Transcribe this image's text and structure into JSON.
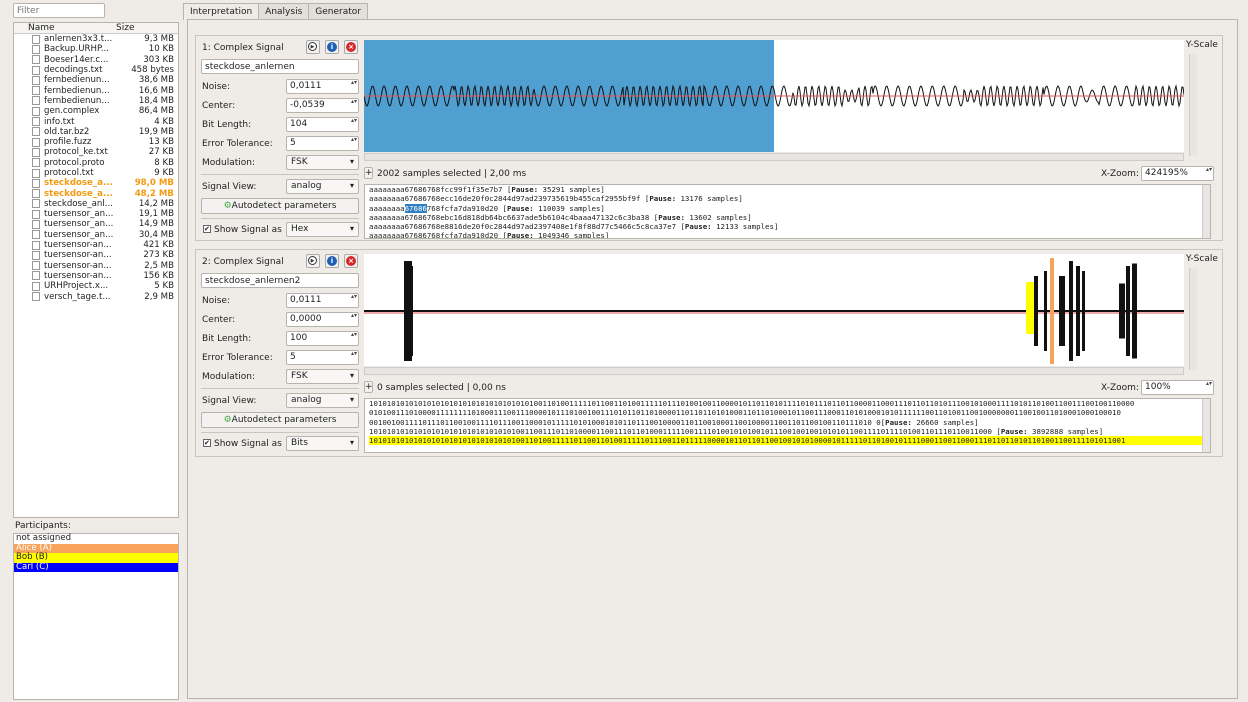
{
  "filter_placeholder": "Filter",
  "tree": {
    "headers": [
      "Name",
      "Size"
    ],
    "files": [
      {
        "name": "anlernen3x3.t...",
        "size": "9,3 MB"
      },
      {
        "name": "Backup.URHP...",
        "size": "10 KB"
      },
      {
        "name": "Boeser14er.c...",
        "size": "303 KB"
      },
      {
        "name": "decodings.txt",
        "size": "458 bytes"
      },
      {
        "name": "fernbedienun...",
        "size": "38,6 MB"
      },
      {
        "name": "fernbedienun...",
        "size": "16,6 MB"
      },
      {
        "name": "fernbedienun...",
        "size": "18,4 MB"
      },
      {
        "name": "gen.complex",
        "size": "86,4 MB"
      },
      {
        "name": "info.txt",
        "size": "4 KB"
      },
      {
        "name": "old.tar.bz2",
        "size": "19,9 MB"
      },
      {
        "name": "profile.fuzz",
        "size": "13 KB"
      },
      {
        "name": "protocol_ke.txt",
        "size": "27 KB"
      },
      {
        "name": "protocol.proto",
        "size": "8 KB"
      },
      {
        "name": "protocol.txt",
        "size": "9 KB"
      },
      {
        "name": "steckdose_a...",
        "size": "98,0 MB",
        "highlight": true
      },
      {
        "name": "steckdose_a...",
        "size": "48,2 MB",
        "highlight": true
      },
      {
        "name": "steckdose_anl...",
        "size": "14,2 MB"
      },
      {
        "name": "tuersensor_an...",
        "size": "19,1 MB"
      },
      {
        "name": "tuersensor_an...",
        "size": "14,9 MB"
      },
      {
        "name": "tuersensor_an...",
        "size": "30,4 MB"
      },
      {
        "name": "tuersensor-an...",
        "size": "421 KB"
      },
      {
        "name": "tuersensor-an...",
        "size": "273 KB"
      },
      {
        "name": "tuersensor-an...",
        "size": "2,5 MB"
      },
      {
        "name": "tuersensor-an...",
        "size": "156 KB"
      },
      {
        "name": "URHProject.x...",
        "size": "5 KB"
      },
      {
        "name": "versch_tage.t...",
        "size": "2,9 MB"
      }
    ]
  },
  "participants": {
    "label": "Participants:",
    "items": [
      {
        "name": "not assigned",
        "bg": "#ffffff",
        "fg": "#222222"
      },
      {
        "name": "Alice (A)",
        "bg": "#f7a35c",
        "fg": "#ffffff"
      },
      {
        "name": "Bob (B)",
        "bg": "#ffff00",
        "fg": "#222222"
      },
      {
        "name": "Carl (C)",
        "bg": "#0000ff",
        "fg": "#ffffff"
      }
    ]
  },
  "tabs": [
    "Interpretation",
    "Analysis",
    "Generator"
  ],
  "labels": {
    "noise": "Noise:",
    "center": "Center:",
    "bit_length": "Bit Length:",
    "error_tolerance": "Error Tolerance:",
    "modulation": "Modulation:",
    "signal_view": "Signal View:",
    "autodetect": "Autodetect parameters",
    "show_signal_as": "Show Signal as",
    "y_scale": "Y-Scale",
    "x_zoom": "X-Zoom:",
    "pause": "Pause:"
  },
  "signals": [
    {
      "title": "1: Complex Signal",
      "name": "steckdose_anlernen",
      "noise": "0,0111",
      "center": "-0,0539",
      "bit_length": "104",
      "error_tolerance": "5",
      "modulation": "FSK",
      "signal_view": "analog",
      "show_as": "Hex",
      "selection": "2002",
      "selection_text": "samples selected | 2,00 ms",
      "x_zoom": "424195%",
      "lines": [
        {
          "pre": "aaaaaaaa67686768fcc99f1f35e7b7 ",
          "pause": "35291 samples"
        },
        {
          "pre": "aaaaaaaa67686768ecc16de20f0c2844d97ad239735619b455caf2955bf9f ",
          "pause": "13176 samples"
        },
        {
          "pre": "aaaaaaaa",
          "sel": "67686",
          "post": "768fcfa7da910d20 ",
          "pause": "110039 samples"
        },
        {
          "pre": "aaaaaaaa67686768ebc16d818db64bc6637ade5b6104c4baaa47132c6c3ba38 ",
          "pause": "13602 samples"
        },
        {
          "pre": "aaaaaaaa67686768e8816de20f0c2844d97ad2397408e1f8f88d77c5466c5c8ca37e7 ",
          "pause": "12133 samples"
        },
        {
          "pre": "aaaaaaaa67686768fcfa7da910d20 ",
          "pause": "1049346 samples"
        }
      ]
    },
    {
      "title": "2: Complex Signal",
      "name": "steckdose_anlernen2",
      "noise": "0,0111",
      "center": "0,0000",
      "bit_length": "100",
      "error_tolerance": "5",
      "modulation": "FSK",
      "signal_view": "analog",
      "show_as": "Bits",
      "selection": "0",
      "selection_text": "samples selected | 0,00 ns",
      "x_zoom": "100%",
      "lines": [
        {
          "pre": "1010101010101010101010101010101010101001101001111101100110100111110111010010011000010110110101111010111011011000011000111011011010111001010001111010110100110011100100110000"
        },
        {
          "pre": "0101001110100001111111101000111001110000101110100100111010110110100001101101101010001101101000101100111000110101000101011111100110100110010000000110010011010001000100010"
        },
        {
          "pre": "00100100111101110110010011110111001100010111110101000101011011100100001101100100011001000011001101100100110111010 0",
          "pause": "26660 samples"
        },
        {
          "pre": "10101010101010101010101010101010100110011101101000011001110110100011111001111010010101001011100100100101010110011110111101001101110110011000 ",
          "pause": "3892888 samples"
        },
        {
          "pre": "10101010101010101010101010101010100110100111110110011010011111011100110111110000101101101100100101010000101111101101001011110001100110001110110110101101001100111101011001",
          "highlight": true
        }
      ]
    }
  ],
  "colors": {
    "selection": "#4f9fd1",
    "center_line": "#e05a5a",
    "alice": "#f7a35c",
    "bob": "#ffff00"
  }
}
